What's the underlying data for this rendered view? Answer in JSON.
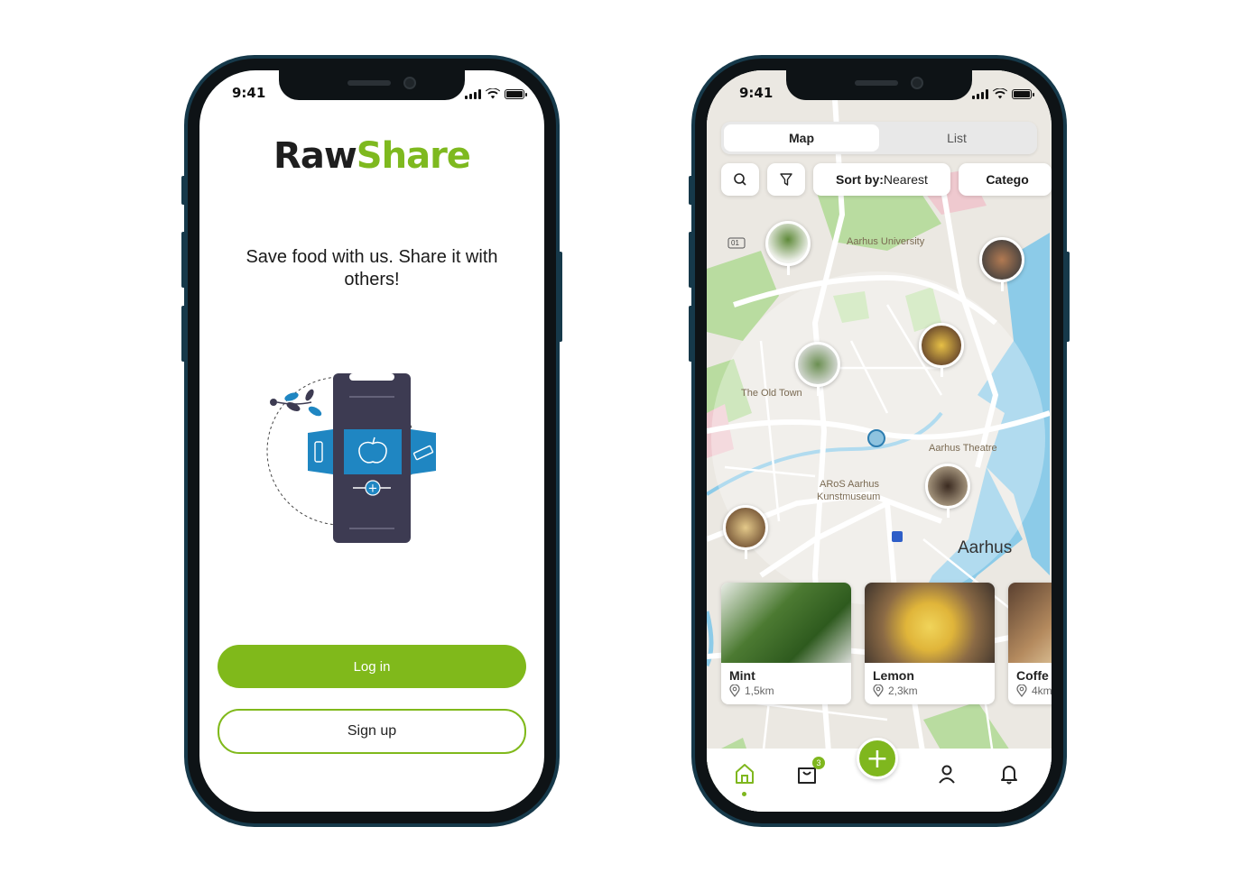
{
  "status": {
    "time": "9:41"
  },
  "welcome": {
    "logo_raw": "Raw",
    "logo_share": "Share",
    "tagline": "Save food with us. Share it with others!",
    "login_label": "Log in",
    "signup_label": "Sign up"
  },
  "map_screen": {
    "tabs": [
      {
        "label": "Map"
      },
      {
        "label": "List"
      }
    ],
    "sort_prefix": "Sort by:",
    "sort_value": " Nearest",
    "category_label": "Catego",
    "map_labels": {
      "university": "Aarhus University",
      "old_town": "The Old Town",
      "theatre": "Aarhus Theatre",
      "aros1": "ARoS Aarhus",
      "aros2": "Kunstmuseum",
      "city": "Aarhus",
      "road": "01"
    },
    "cards": [
      {
        "name": "Mint",
        "distance": "1,5km"
      },
      {
        "name": "Lemon",
        "distance": "2,3km"
      },
      {
        "name": "Coffe",
        "distance": "4km"
      }
    ],
    "cart_count": "3"
  },
  "colors": {
    "brand_green": "#80b91b",
    "frame": "#16394a",
    "water": "#8ccbe8",
    "park": "#b9dca0"
  }
}
